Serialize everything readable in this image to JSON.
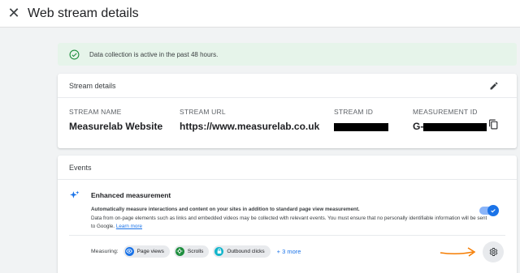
{
  "header": {
    "title": "Web stream details"
  },
  "banner": {
    "text": "Data collection is active in the past 48 hours."
  },
  "stream_details": {
    "title": "Stream details",
    "stream_name_label": "STREAM NAME",
    "stream_name": "Measurelab Website",
    "stream_url_label": "STREAM URL",
    "stream_url": "https://www.measurelab.co.uk",
    "stream_id_label": "STREAM ID",
    "measurement_id_label": "MEASUREMENT ID",
    "measurement_id_prefix": "G-"
  },
  "events": {
    "title": "Events",
    "enhanced_title": "Enhanced measurement",
    "desc_line1": "Automatically measure interactions and content on your sites in addition to standard page view measurement.",
    "desc_line2": "Data from on-page elements such as links and embedded videos may be collected with relevant events. You must ensure that no personally identifiable information will be sent to Google.",
    "learn_more": "Learn more",
    "toggle_on": true,
    "measuring_label": "Measuring:",
    "chips": [
      {
        "label": "Page views",
        "icon": "eye-icon",
        "color": "#1a73e8"
      },
      {
        "label": "Scrolls",
        "icon": "crosshair-icon",
        "color": "#1e8e3e"
      },
      {
        "label": "Outbound clicks",
        "icon": "lock-icon",
        "color": "#12b5cb"
      }
    ],
    "more": "+ 3 more"
  },
  "colors": {
    "accent": "#1a73e8",
    "banner_bg": "#e6f4ea",
    "success": "#1e8e3e",
    "arrow": "#f57c00"
  }
}
